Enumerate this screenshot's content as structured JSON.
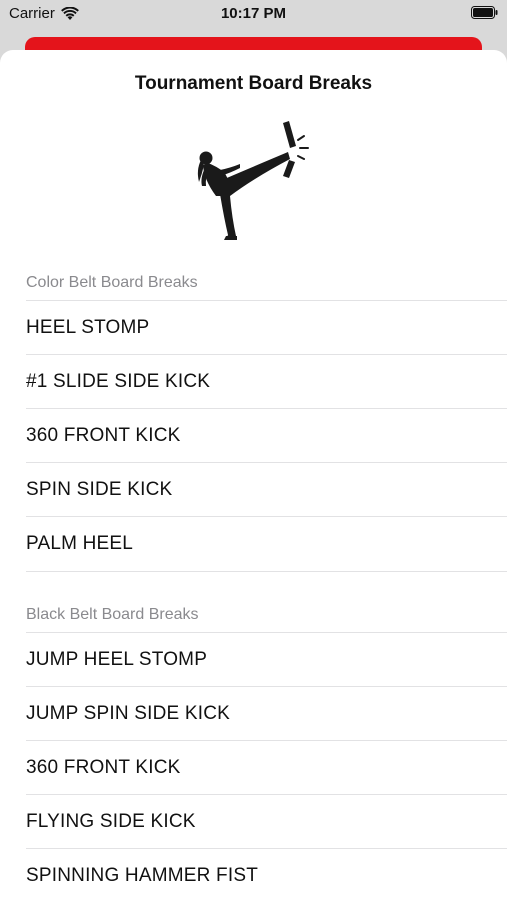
{
  "status_bar": {
    "carrier": "Carrier",
    "time": "10:17 PM"
  },
  "sheet": {
    "title": "Tournament Board Breaks",
    "image_icon": "kicking-martial-artist-silhouette"
  },
  "sections": [
    {
      "header": "Color Belt Board Breaks",
      "items": [
        "HEEL STOMP",
        "#1 SLIDE SIDE KICK",
        "360 FRONT KICK",
        "SPIN SIDE KICK",
        "PALM HEEL"
      ]
    },
    {
      "header": "Black Belt Board Breaks",
      "items": [
        "JUMP HEEL STOMP",
        "JUMP SPIN SIDE KICK",
        "360 FRONT KICK",
        "FLYING SIDE KICK",
        "SPINNING HAMMER FIST"
      ]
    }
  ],
  "colors": {
    "accent_red": "#e4141b",
    "section_header": "#8a8a8e"
  }
}
